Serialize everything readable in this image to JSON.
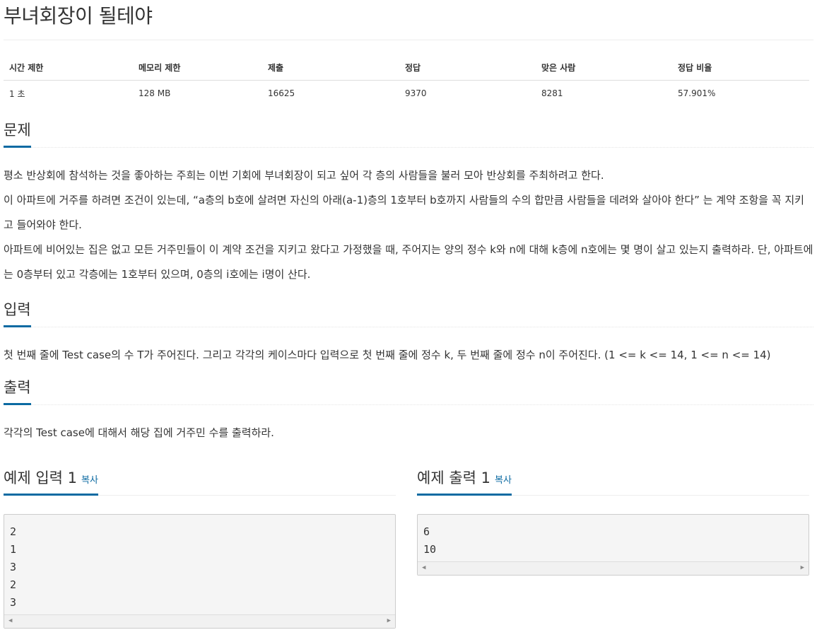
{
  "problem": {
    "title": "부녀회장이 될테야",
    "info": {
      "headers": [
        "시간 제한",
        "메모리 제한",
        "제출",
        "정답",
        "맞은 사람",
        "정답 비율"
      ],
      "values": [
        "1 초",
        "128 MB",
        "16625",
        "9370",
        "8281",
        "57.901%"
      ]
    },
    "sections": {
      "description": {
        "heading": "문제",
        "paragraphs": [
          "평소 반상회에 참석하는 것을 좋아하는 주희는 이번 기회에 부녀회장이 되고 싶어 각 층의 사람들을 불러 모아 반상회를 주최하려고 한다.",
          "이 아파트에 거주를 하려면 조건이 있는데, “a층의 b호에 살려면 자신의 아래(a-1)층의 1호부터 b호까지 사람들의 수의 합만큼 사람들을 데려와 살아야 한다” 는 계약 조항을 꼭 지키고 들어와야 한다.",
          "아파트에 비어있는 집은 없고 모든 거주민들이 이 계약 조건을 지키고 왔다고 가정했을 때, 주어지는 양의 정수 k와 n에 대해 k층에 n호에는 몇 명이 살고 있는지 출력하라. 단, 아파트에는 0층부터 있고 각층에는 1호부터 있으며, 0층의 i호에는 i명이 산다."
        ]
      },
      "input": {
        "heading": "입력",
        "text": "첫 번째 줄에 Test case의 수 T가 주어진다. 그리고 각각의 케이스마다 입력으로 첫 번째 줄에 정수 k, 두 번째 줄에 정수 n이 주어진다. (1 <= k <= 14, 1 <= n <= 14)"
      },
      "output": {
        "heading": "출력",
        "text": "각각의 Test case에 대해서 해당 집에 거주민 수를 출력하라."
      }
    },
    "samples": {
      "input": {
        "label": "예제 입력 1",
        "copy": "복사",
        "content": "2\n1\n3\n2\n3"
      },
      "output": {
        "label": "예제 출력 1",
        "copy": "복사",
        "content": "6\n10"
      }
    }
  },
  "colors": {
    "accent": "#0b6aa2",
    "sample_bg": "#f5f5f5"
  },
  "icons": {
    "scroll_left": "scroll-left-arrow-icon",
    "scroll_right": "scroll-right-arrow-icon"
  }
}
